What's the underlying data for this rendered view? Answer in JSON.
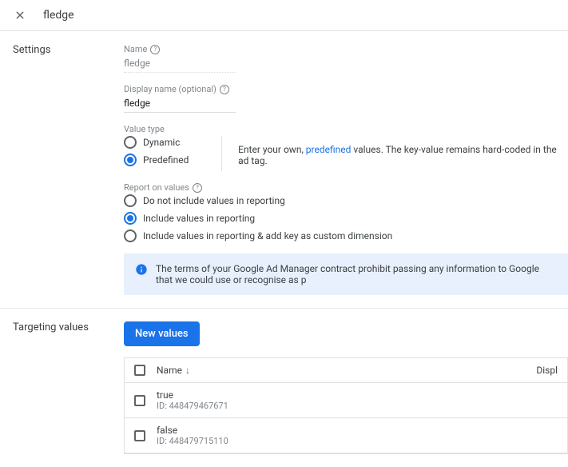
{
  "header": {
    "title": "fledge"
  },
  "settings": {
    "section_label": "Settings",
    "name": {
      "label": "Name",
      "value": "fledge"
    },
    "display_name": {
      "label": "Display name (optional)",
      "value": "fledge"
    },
    "value_type": {
      "label": "Value type",
      "options": {
        "dynamic": "Dynamic",
        "predefined": "Predefined"
      },
      "selected": "predefined",
      "help_prefix": "Enter your own, ",
      "help_link": "predefined",
      "help_suffix": " values. The key-value remains hard-coded in the ad tag."
    },
    "report": {
      "label": "Report on values",
      "options": {
        "none": "Do not include values in reporting",
        "include": "Include values in reporting",
        "custom": "Include values in reporting & add key as custom dimension"
      },
      "selected": "include"
    },
    "info_banner": "The terms of your Google Ad Manager contract prohibit passing any information to Google that we could use or recognise as p"
  },
  "targeting": {
    "section_label": "Targeting values",
    "new_button": "New values",
    "columns": {
      "name": "Name",
      "display": "Displ"
    },
    "rows": [
      {
        "name": "true",
        "id": "ID: 448479467671"
      },
      {
        "name": "false",
        "id": "ID: 448479715110"
      }
    ]
  }
}
